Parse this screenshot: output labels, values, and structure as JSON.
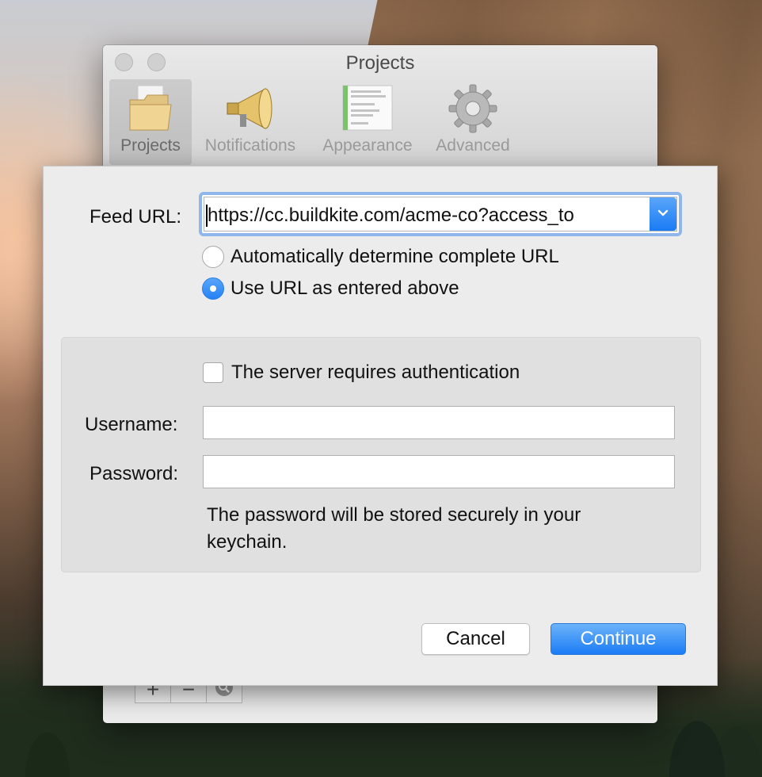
{
  "window": {
    "title": "Projects",
    "toolbar": [
      {
        "label": "Projects",
        "icon": "folder-icon",
        "selected": true
      },
      {
        "label": "Notifications",
        "icon": "megaphone-icon",
        "selected": false
      },
      {
        "label": "Appearance",
        "icon": "appearance-icon",
        "selected": false
      },
      {
        "label": "Advanced",
        "icon": "gear-icon",
        "selected": false
      }
    ],
    "bottom_buttons": [
      "+",
      "−",
      "search"
    ]
  },
  "sheet": {
    "feed_url_label": "Feed URL:",
    "feed_url_value": "https://cc.buildkite.com/acme-co?access_to",
    "radio_options": [
      {
        "label": "Automatically determine complete URL",
        "selected": false
      },
      {
        "label": "Use URL as entered above",
        "selected": true
      }
    ],
    "auth": {
      "checkbox_label": "The server requires authentication",
      "checked": false,
      "username_label": "Username:",
      "username_value": "",
      "password_label": "Password:",
      "password_value": "",
      "note": "The password will be stored securely in your keychain."
    },
    "buttons": {
      "cancel": "Cancel",
      "continue": "Continue"
    }
  },
  "colors": {
    "accent": "#1b7cf5",
    "focus_ring": "#8fb7ec",
    "window_bg": "#ececec"
  }
}
